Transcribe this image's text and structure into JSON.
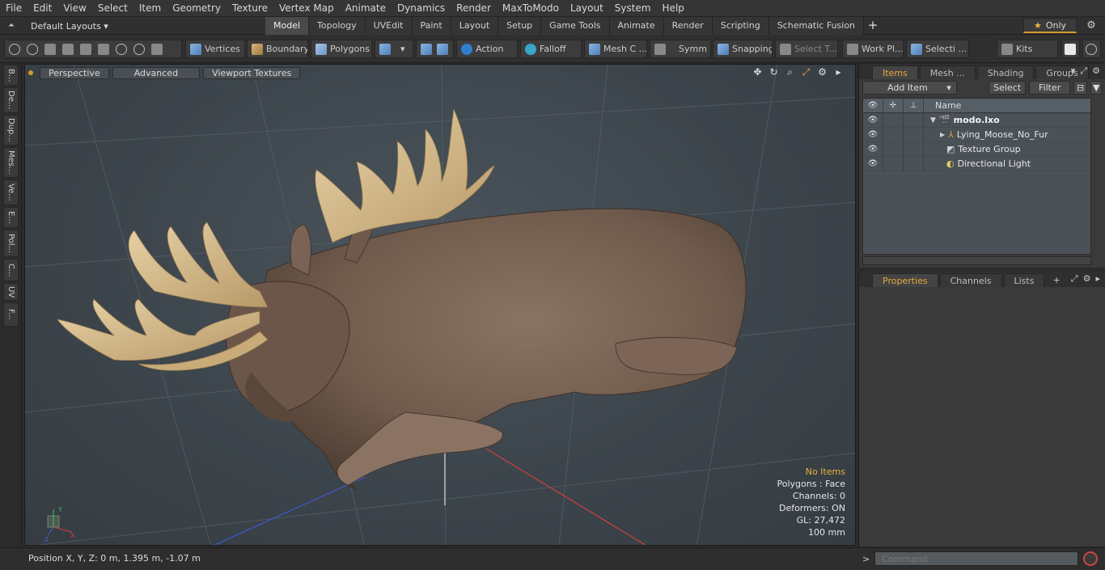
{
  "menu": [
    "File",
    "Edit",
    "View",
    "Select",
    "Item",
    "Geometry",
    "Texture",
    "Vertex Map",
    "Animate",
    "Dynamics",
    "Render",
    "MaxToModo",
    "Layout",
    "System",
    "Help"
  ],
  "layoutbar": {
    "layouts_label": "Default Layouts ▾",
    "tabs": [
      "Model",
      "Topology",
      "UVEdit",
      "Paint",
      "Layout",
      "Setup",
      "Game Tools",
      "Animate",
      "Render",
      "Scripting",
      "Schematic Fusion"
    ],
    "active_tab": "Model",
    "plus": "+",
    "only_label": "Only"
  },
  "toolbar": {
    "vertices": "Vertices",
    "boundary": "Boundary",
    "polygons": "Polygons",
    "action": "Action",
    "falloff": "Falloff",
    "mesh_c": "Mesh C ...",
    "symm": "Symm ...",
    "snapping": "Snapping",
    "select_t": "Select T...",
    "work_pl": "Work Pl...",
    "selecti": "Selecti ...",
    "kits": "Kits"
  },
  "side_tabs": [
    "B...",
    "De...",
    "Dup...",
    "Mes...",
    "Ve...",
    "E...",
    "Pol...",
    "C...",
    "UV",
    "F..."
  ],
  "viewport": {
    "perspective": "Perspective",
    "advanced": "Advanced",
    "viewport_textures": "Viewport Textures",
    "info": {
      "no_items": "No Items",
      "polygons": "Polygons : Face",
      "channels": "Channels: 0",
      "deformers": "Deformers: ON",
      "gl": "GL: 27,472",
      "scale": "100 mm"
    },
    "axis_labels": {
      "y": "Y",
      "x": "X",
      "z": "Z"
    }
  },
  "items_panel": {
    "tabs": [
      "Items",
      "Mesh ...",
      "Shading",
      "Groups"
    ],
    "active_tab": "Items",
    "add_item": "Add Item",
    "select": "Select",
    "filter": "Filter",
    "col_name": "Name",
    "rows": [
      {
        "label": "modo.lxo",
        "indent": 0
      },
      {
        "label": "Lying_Moose_No_Fur",
        "indent": 1
      },
      {
        "label": "Texture Group",
        "indent": 1
      },
      {
        "label": "Directional Light",
        "indent": 1
      }
    ]
  },
  "props_panel": {
    "tabs": [
      "Properties",
      "Channels",
      "Lists"
    ],
    "active_tab": "Properties",
    "plus": "+"
  },
  "status": {
    "position": "Position X, Y, Z:   0 m, 1.395 m, -1.07 m",
    "command_placeholder": "Command",
    "prompt": ">"
  },
  "colors": {
    "accent": "#e6a83a",
    "viewport_bg": "#3d454c",
    "moose_fur": "#7a6354",
    "antler": "#d8bd8e"
  }
}
